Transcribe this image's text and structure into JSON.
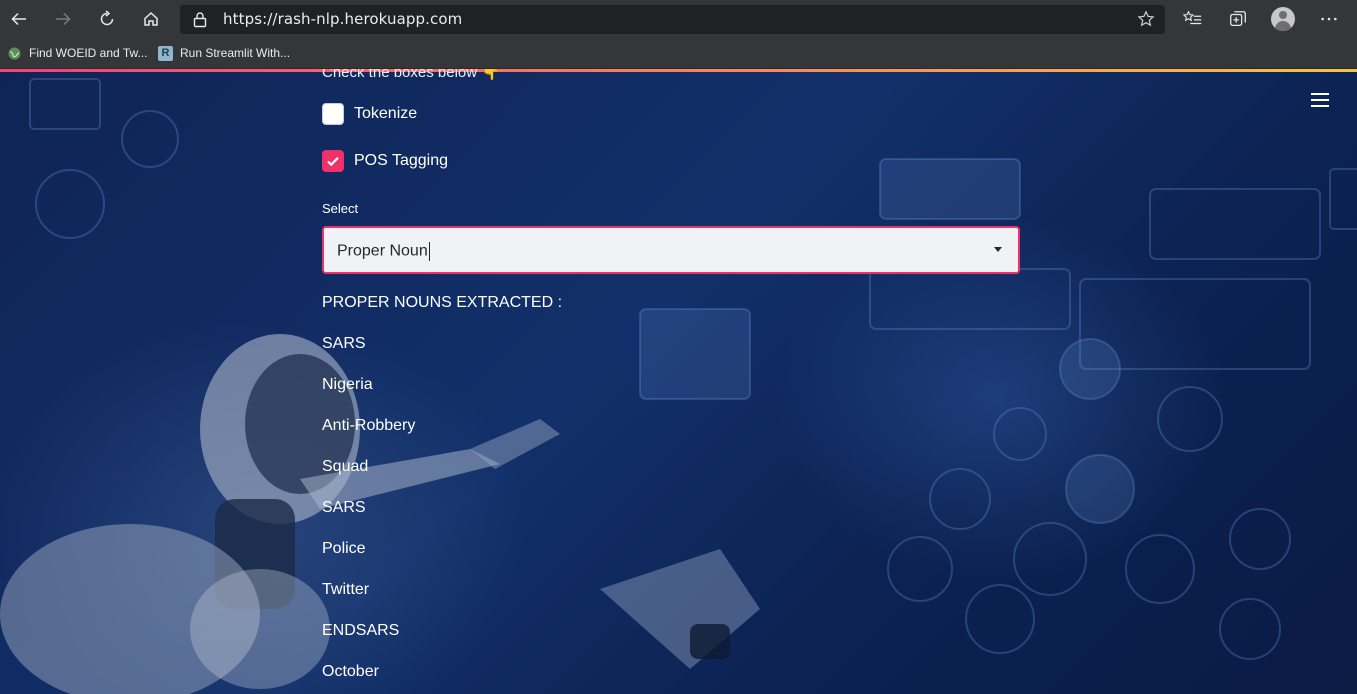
{
  "browser": {
    "url": "https://rash-nlp.herokuapp.com",
    "bookmarks": [
      "Find WOEID and Tw...",
      "Run Streamlit With..."
    ],
    "bookmark_icon_letter": "R"
  },
  "app": {
    "instruction": "Check the boxes below 👇",
    "checkboxes": [
      {
        "label": "Tokenize",
        "checked": false
      },
      {
        "label": "POS Tagging",
        "checked": true
      }
    ],
    "select": {
      "label": "Select",
      "value": "Proper Noun"
    },
    "result_heading": "PROPER NOUNS EXTRACTED :",
    "proper_nouns": [
      "SARS",
      "Nigeria",
      "Anti-Robbery",
      "Squad",
      "SARS",
      "Police",
      "Twitter",
      "ENDSARS",
      "October"
    ]
  },
  "colors": {
    "accent": "#f0306a",
    "chrome": "#35363a",
    "address_bar": "#202124",
    "page_background": "#12306a"
  }
}
